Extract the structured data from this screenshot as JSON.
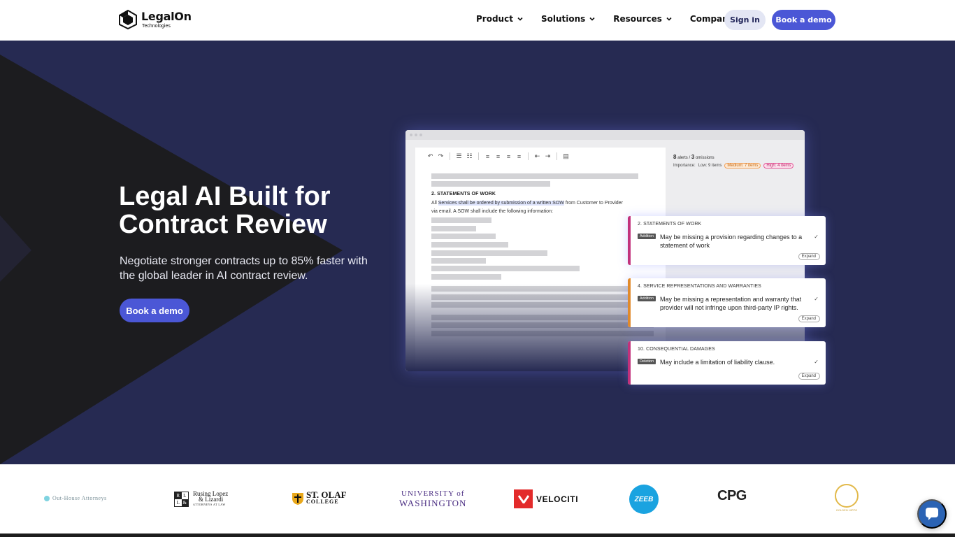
{
  "brand": {
    "name": "LegalOn",
    "sub": "Technologies"
  },
  "nav": {
    "items": [
      {
        "label": "Product"
      },
      {
        "label": "Solutions"
      },
      {
        "label": "Resources"
      },
      {
        "label": "Company"
      }
    ],
    "signin_label": "Sign in",
    "demo_label": "Book a demo"
  },
  "hero": {
    "title_line1": "Legal AI Built for",
    "title_line2": "Contract Review",
    "subtitle": "Negotiate stronger contracts up to 85% faster with the global leader in AI contract review.",
    "cta_label": "Book a demo"
  },
  "mock": {
    "summary_alerts_count": "8",
    "summary_alerts_label": "alerts /",
    "summary_omissions_count": "3",
    "summary_omissions_label": "omissions",
    "importance_label": "Importance:",
    "low_label": "Low: 9 items",
    "medium_label": "Medium: 7 items",
    "high_label": "High: 4 items",
    "doc_heading": "2. STATEMENTS OF WORK",
    "doc_line1_pre": "All ",
    "doc_line1_hl": "Services shall be ordered by submission of a written SOW",
    "doc_line1_post": " from Customer to Provider",
    "doc_line2": "via email. A SOW shall include the following information:"
  },
  "alerts": [
    {
      "title": "2. STATEMENTS OF WORK",
      "tag": "Addition",
      "text": "May be missing a provision regarding changes to a statement of work",
      "expand": "Expand",
      "accent": "#c2317b"
    },
    {
      "title": "4. SERVICE REPRESENTATIONS AND WARRANTIES",
      "tag": "Addition",
      "text": "May be missing a representation and warranty that provider will not infringe upon third-party IP rights.",
      "expand": "Expand",
      "accent": "#e08a2c"
    },
    {
      "title": "10. CONSEQUENTIAL DAMAGES",
      "tag": "Deletion",
      "text": "May include a limitation of liability clause.",
      "expand": "Expand",
      "accent": "#c2317b"
    }
  ],
  "clients": {
    "outhouse": "Out-House Attorneys",
    "rusing_line1": "Rusing Lopez",
    "rusing_line2": "& Lizardi",
    "rusing_line3": "ATTORNEYS AT LAW",
    "stolaf_line1": "ST. OLAF",
    "stolaf_line2": "COLLEGE",
    "uw_line1": "UNIVERSITY of",
    "uw_line2": "WASHINGTON",
    "velociti": "VELOCITI",
    "zeeb": "ZEEB",
    "cpg": "CPG",
    "golden": "GOLDEN HIPPO"
  },
  "colors": {
    "accent": "#4b57d6",
    "hero_bg": "#262a52",
    "chat": "#2b63b4"
  }
}
